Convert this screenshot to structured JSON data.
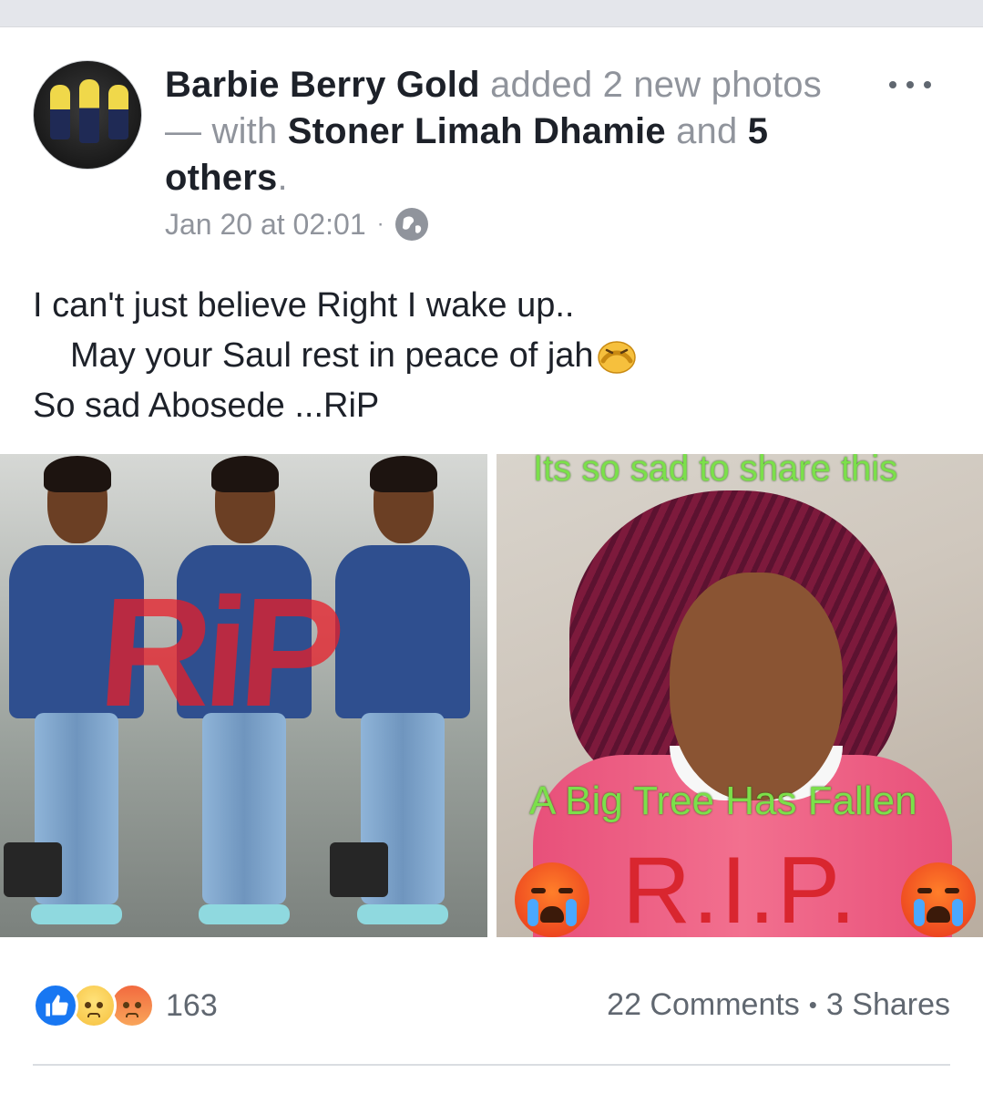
{
  "post": {
    "author": "Barbie Berry Gold",
    "action": "added 2 new photos — with",
    "tagged_person": "Stoner Limah Dhamie",
    "and_word": "and",
    "others": "5 others",
    "period": ".",
    "timestamp": "Jan 20 at 02:01",
    "separator": "·",
    "audience_icon": "globe-icon",
    "more_icon": "more-options-icon",
    "text_lines": [
      "I can't just believe Right I wake up..",
      "May your Saul rest in peace of jah",
      "So sad Abosede ...RiP"
    ],
    "text_emoji": "shushing-face-emoji"
  },
  "photos": {
    "photo1": {
      "overlay_text": "RiP"
    },
    "photo2": {
      "caption_top": "Its so sad to share this",
      "caption_middle": "A Big Tree Has Fallen",
      "caption_rip": "R.I.P.",
      "emoji": "crying-face-emoji"
    }
  },
  "footer": {
    "reaction_icons": [
      "like-icon",
      "sad-icon",
      "angry-icon"
    ],
    "reaction_count": "163",
    "comments": "22 Comments",
    "separator": "•",
    "shares": "3 Shares"
  },
  "colors": {
    "link_text": "#1d2129",
    "muted_text": "#90949c",
    "like_blue": "#1877f2",
    "rip_red": "#d9262f",
    "caption_green": "#7be04a"
  }
}
